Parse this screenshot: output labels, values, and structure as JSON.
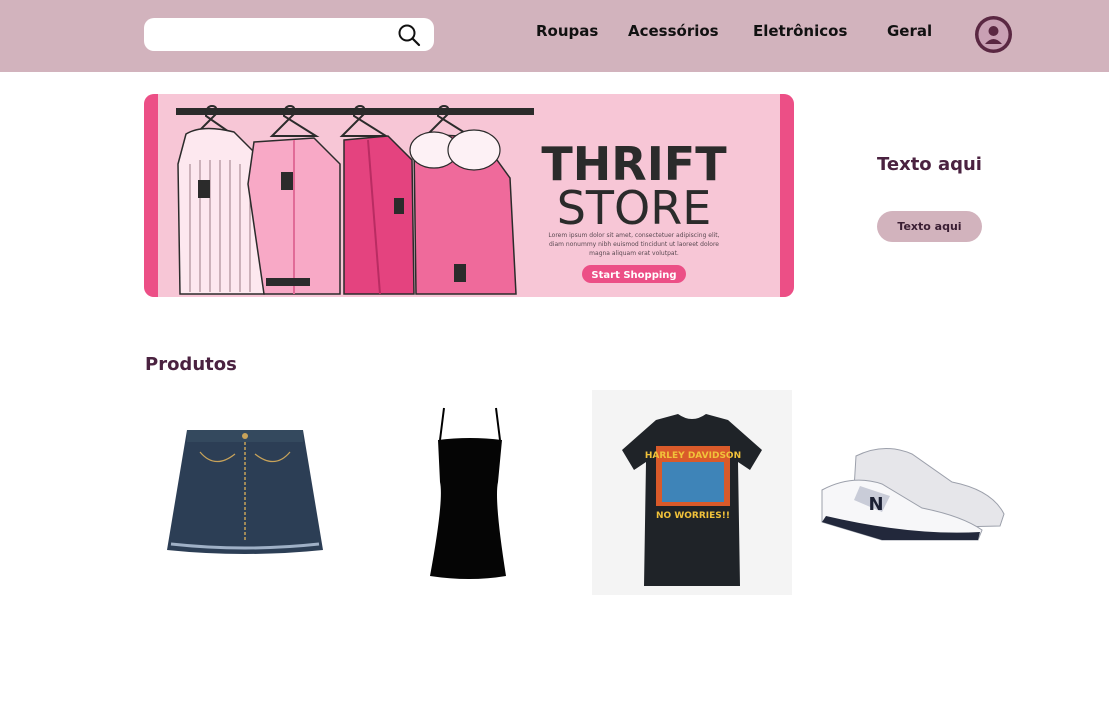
{
  "header": {
    "search": {
      "placeholder": "",
      "value": ""
    },
    "nav": [
      "Roupas",
      "Acessórios",
      "Eletrônicos",
      "Geral"
    ]
  },
  "banner": {
    "title_line1": "THRIFT",
    "title_line2": "STORE",
    "body_text_1": "Lorem ipsum dolor sit amet, consectetuer adipiscing elit,",
    "body_text_2": "diam nonummy nibh euismod tincidunt ut laoreet dolore",
    "body_text_3": "magna aliquam erat volutpat.",
    "cta": "Start Shopping"
  },
  "side_panel": {
    "title": "Texto aqui",
    "button": "Texto aqui"
  },
  "products_section": {
    "title": "Produtos",
    "items": [
      {
        "icon": "denim-skirt-image"
      },
      {
        "icon": "black-dress-image"
      },
      {
        "icon": "black-tshirt-image",
        "print_text": "HARLEY DAVIDSON",
        "print_sub": "NO WORRIES!!"
      },
      {
        "icon": "white-sneakers-image",
        "logo_text": "N"
      }
    ]
  },
  "colors": {
    "header_bg": "#d2b3bd",
    "accent_dark": "#4a2240",
    "banner_pink": "#f7c6d6",
    "banner_hot_pink": "#ec4f86"
  }
}
